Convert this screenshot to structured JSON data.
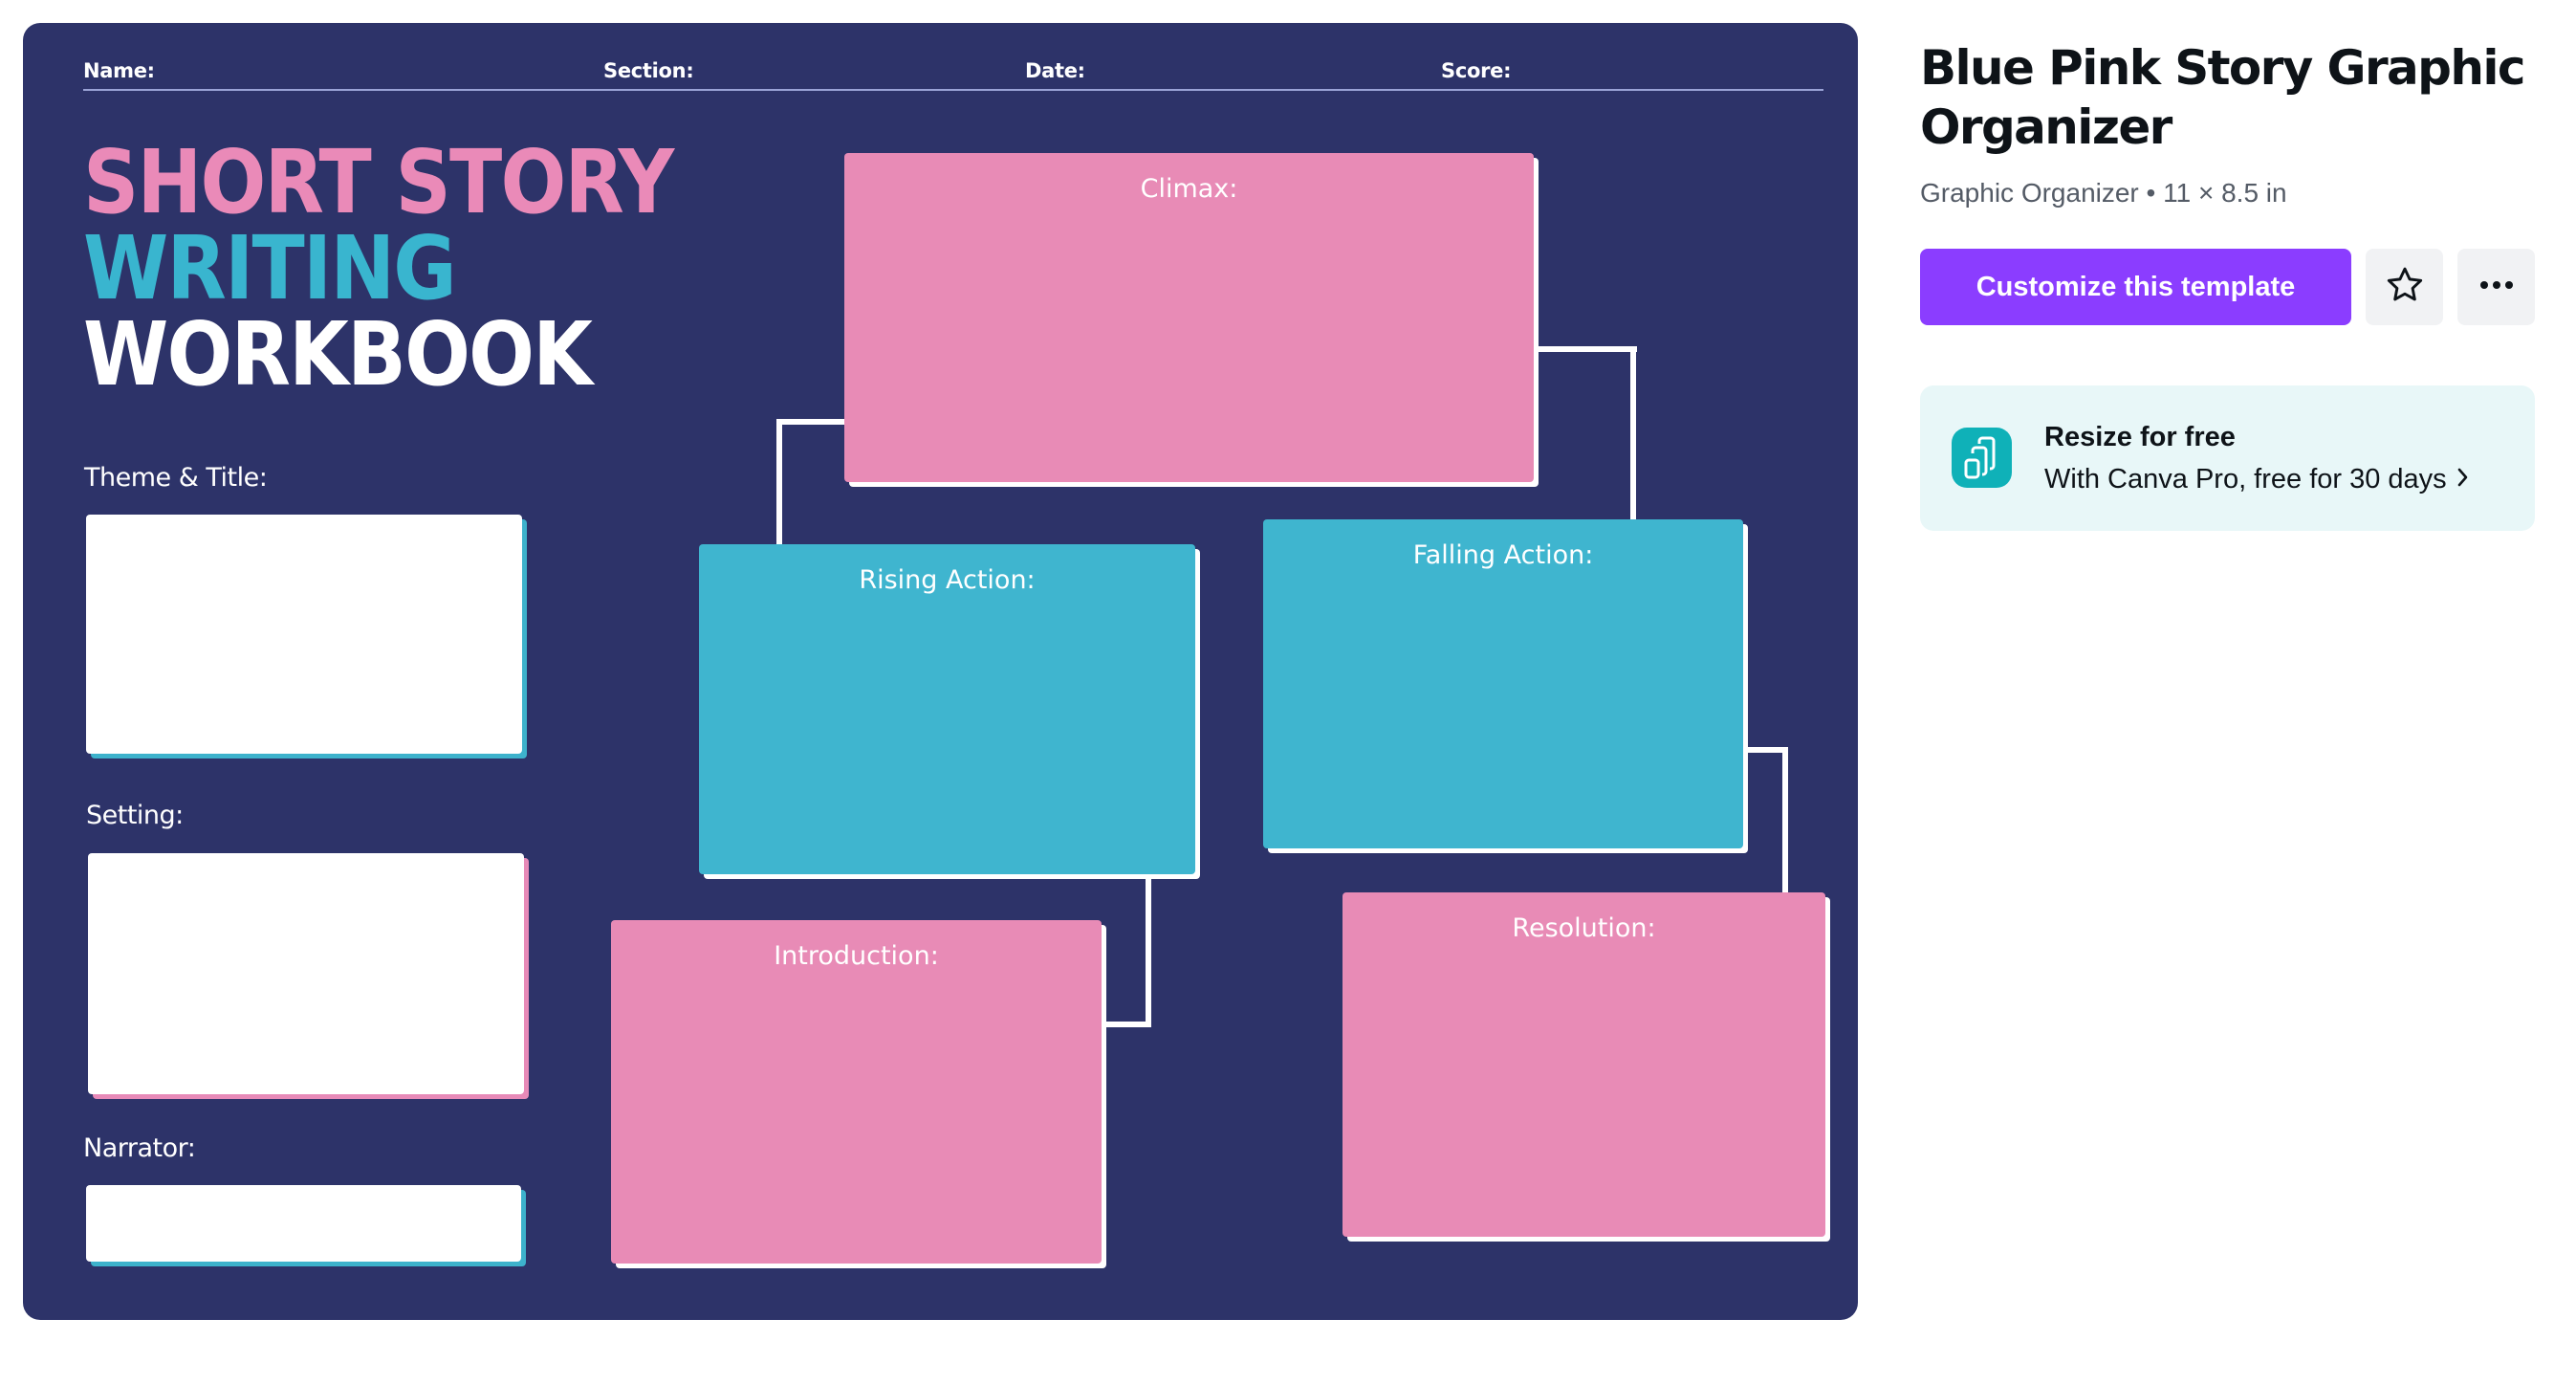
{
  "worksheet": {
    "header_fields": [
      {
        "label": "Name:"
      },
      {
        "label": "Section:"
      },
      {
        "label": "Date:"
      },
      {
        "label": "Score:"
      }
    ],
    "title_lines": [
      {
        "text": "SHORT STORY",
        "color": "#ea8ab8"
      },
      {
        "text": "WRITING",
        "color": "#39b5cf"
      },
      {
        "text": "WORKBOOK",
        "color": "#ffffff"
      }
    ],
    "side_fields": [
      {
        "label": "Theme & Title:",
        "accent": "#3db2cc"
      },
      {
        "label": "Setting:",
        "accent": "#e78ab8"
      },
      {
        "label": "Narrator:",
        "accent": "#3db2cc"
      }
    ],
    "plot_boxes": {
      "climax": {
        "label": "Climax:",
        "color": "#e88bb6"
      },
      "rising_action": {
        "label": "Rising Action:",
        "color": "#3fb5cf"
      },
      "falling_action": {
        "label": "Falling Action:",
        "color": "#3fb5cf"
      },
      "introduction": {
        "label": "Introduction:",
        "color": "#e88bb6"
      },
      "resolution": {
        "label": "Resolution:",
        "color": "#e88bb6"
      }
    },
    "background_color": "#2d3369"
  },
  "panel": {
    "title": "Blue Pink Story Graphic Organizer",
    "subtitle": "Graphic Organizer • 11 × 8.5 in",
    "customize_button": "Customize this template",
    "favorite_icon": "star-outline-icon",
    "more_icon": "more-horizontal-icon",
    "resize_card": {
      "icon": "resize-icon",
      "title": "Resize for free",
      "subtitle": "With Canva Pro, free for 30 days",
      "chevron_icon": "chevron-right-icon"
    },
    "accent_color": "#8b3dff"
  }
}
